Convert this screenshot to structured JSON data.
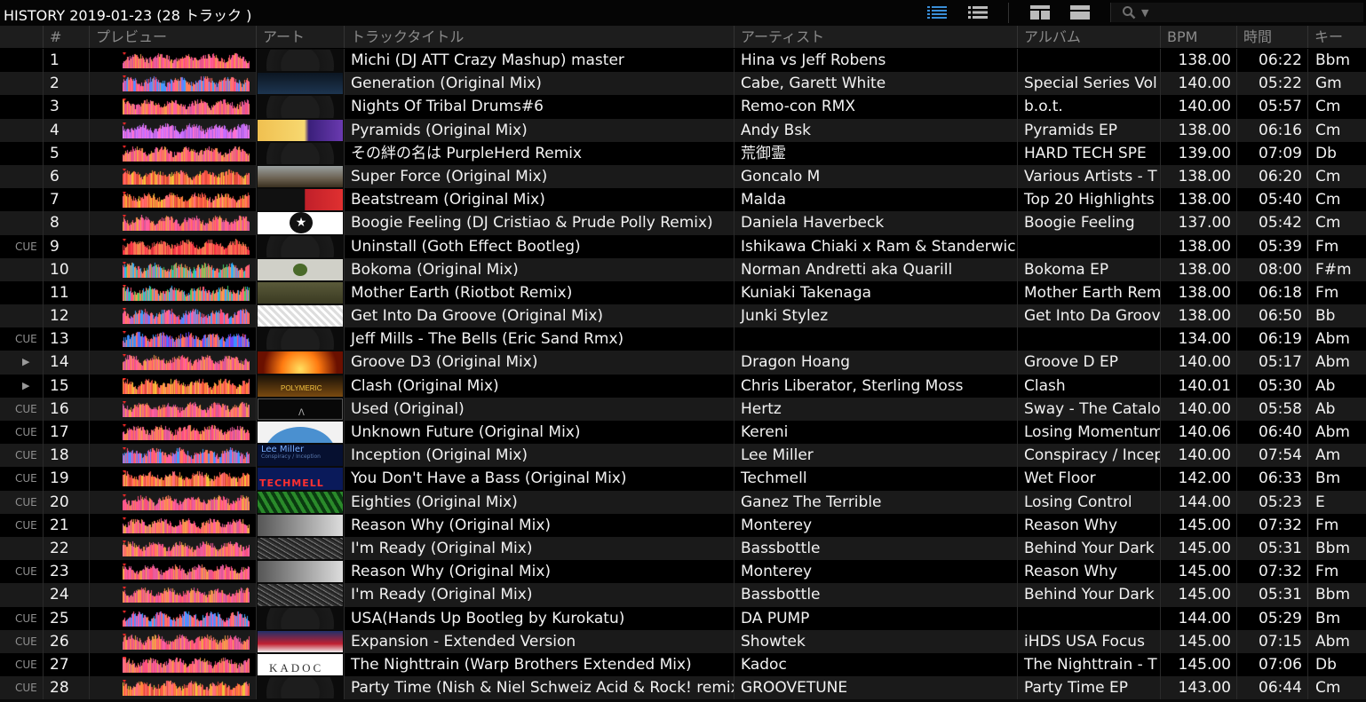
{
  "window": {
    "title": "HISTORY 2019-01-23 (28 トラック )"
  },
  "toolbar": {
    "icons": [
      "list-detail-icon",
      "list-compact-icon",
      "artwork-view-icon",
      "artwork-split-icon",
      "search-icon"
    ],
    "accent": "#3a8fd9"
  },
  "columns": [
    "#",
    "プレビュー",
    "アート",
    "トラックタイトル",
    "アーティスト",
    "アルバム",
    "BPM",
    "時間",
    "キー"
  ],
  "tracks": [
    {
      "flag": "",
      "num": "1",
      "title": "Michi (DJ ATT Crazy Mashup) master",
      "artist": "Hina vs Jeff Robens",
      "album": "",
      "bpm": "138.00",
      "time": "06:22",
      "key": "Bbm",
      "art": "disc",
      "wave": "pink"
    },
    {
      "flag": "",
      "num": "2",
      "title": "Generation (Original Mix)",
      "artist": "Cabe, Garett White",
      "album": "Special Series Vol",
      "bpm": "140.00",
      "time": "05:22",
      "key": "Gm",
      "art": "dark-blue",
      "wave": "pinkblue"
    },
    {
      "flag": "",
      "num": "3",
      "title": "Nights Of Tribal Drums#6",
      "artist": "Remo-con RMX",
      "album": "b.o.t.",
      "bpm": "140.00",
      "time": "05:57",
      "key": "Cm",
      "art": "disc",
      "wave": "pink"
    },
    {
      "flag": "",
      "num": "4",
      "title": "Pyramids (Original Mix)",
      "artist": "Andy Bsk",
      "album": "Pyramids EP",
      "bpm": "138.00",
      "time": "06:16",
      "key": "Cm",
      "art": "pyramid",
      "wave": "violet"
    },
    {
      "flag": "",
      "num": "5",
      "title": "その絆の名は PurpleHerd Remix",
      "artist": "荒御霊",
      "album": "HARD TECH SPE",
      "bpm": "139.00",
      "time": "07:09",
      "key": "Db",
      "art": "disc",
      "wave": "pink"
    },
    {
      "flag": "",
      "num": "6",
      "title": "Super Force (Original Mix)",
      "artist": "Goncalo M",
      "album": "Various Artists - T",
      "bpm": "138.00",
      "time": "06:20",
      "key": "Cm",
      "art": "landscape",
      "wave": "orange"
    },
    {
      "flag": "",
      "num": "7",
      "title": "Beatstream (Original Mix)",
      "artist": "Malda",
      "album": "Top 20 Highlights",
      "bpm": "138.00",
      "time": "05:40",
      "key": "Cm",
      "art": "red-black",
      "wave": "orange"
    },
    {
      "flag": "",
      "num": "8",
      "title": "Boogie Feeling (DJ Cristiao & Prude Polly Remix)",
      "artist": "Daniela Haverbeck",
      "album": "Boogie Feeling",
      "bpm": "137.00",
      "time": "05:42",
      "key": "Cm",
      "art": "white-star",
      "wave": "pink"
    },
    {
      "flag": "CUE",
      "num": "9",
      "title": "Uninstall (Goth Effect Bootleg)",
      "artist": "Ishikawa Chiaki x Ram & Standerwick",
      "album": "",
      "bpm": "138.00",
      "time": "05:39",
      "key": "Fm",
      "art": "disc",
      "wave": "red"
    },
    {
      "flag": "",
      "num": "10",
      "title": "Bokoma (Original Mix)",
      "artist": "Norman Andretti aka Quarill",
      "album": "Bokoma EP",
      "bpm": "138.00",
      "time": "08:00",
      "key": "F#m",
      "art": "grey-logo",
      "wave": "green"
    },
    {
      "flag": "",
      "num": "11",
      "title": "Mother Earth (Riotbot Remix)",
      "artist": "Kuniaki Takenaga",
      "album": "Mother Earth Rem",
      "bpm": "138.00",
      "time": "06:18",
      "key": "Fm",
      "art": "olive",
      "wave": "green"
    },
    {
      "flag": "",
      "num": "12",
      "title": "Get Into Da Groove (Original Mix)",
      "artist": "Junki Stylez",
      "album": "Get Into Da Groov",
      "bpm": "138.00",
      "time": "06:50",
      "key": "Bb",
      "art": "sketch",
      "wave": "pinkblue"
    },
    {
      "flag": "CUE",
      "num": "13",
      "title": "Jeff Mills - The Bells (Eric Sand Rmx)",
      "artist": "",
      "album": "",
      "bpm": "134.00",
      "time": "06:19",
      "key": "Abm",
      "art": "disc",
      "wave": "blue"
    },
    {
      "flag": "play",
      "num": "14",
      "title": "Groove D3 (Original Mix)",
      "artist": "Dragon Hoang",
      "album": "Groove D EP",
      "bpm": "140.00",
      "time": "05:17",
      "key": "Abm",
      "art": "fire",
      "wave": "pink"
    },
    {
      "flag": "play",
      "num": "15",
      "title": "Clash (Original Mix)",
      "artist": "Chris Liberator, Sterling Moss",
      "album": "Clash",
      "bpm": "140.01",
      "time": "05:30",
      "key": "Ab",
      "art": "polymeric",
      "wave": "orange"
    },
    {
      "flag": "CUE",
      "num": "16",
      "title": "Used (Original)",
      "artist": "Hertz",
      "album": "Sway - The Catalo",
      "bpm": "140.00",
      "time": "05:58",
      "key": "Ab",
      "art": "black-frame",
      "wave": "pink"
    },
    {
      "flag": "CUE",
      "num": "17",
      "title": "Unknown Future (Original Mix)",
      "artist": "Kereni",
      "album": "Losing Momentum",
      "bpm": "140.06",
      "time": "06:40",
      "key": "Abm",
      "art": "blue-dome",
      "wave": "pink"
    },
    {
      "flag": "CUE",
      "num": "18",
      "title": "Inception (Original Mix)",
      "artist": "Lee Miller",
      "album": "Conspiracy / Incep",
      "bpm": "140.00",
      "time": "07:54",
      "key": "Am",
      "art": "lee-miller",
      "wave": "pinkblue"
    },
    {
      "flag": "CUE",
      "num": "19",
      "title": "You Don't Have a Bass (Original Mix)",
      "artist": "Techmell",
      "album": "Wet Floor",
      "bpm": "142.00",
      "time": "06:33",
      "key": "Bm",
      "art": "techmell",
      "wave": "orange"
    },
    {
      "flag": "CUE",
      "num": "20",
      "title": "Eighties (Original Mix)",
      "artist": "Ganez The Terrible",
      "album": "Losing Control",
      "bpm": "144.00",
      "time": "05:23",
      "key": "E",
      "art": "green-pattern",
      "wave": "pink"
    },
    {
      "flag": "CUE",
      "num": "21",
      "title": "Reason Why (Original Mix)",
      "artist": "Monterey",
      "album": "Reason Why",
      "bpm": "145.00",
      "time": "07:32",
      "key": "Fm",
      "art": "grey-white",
      "wave": "pink"
    },
    {
      "flag": "",
      "num": "22",
      "title": "I'm Ready (Original Mix)",
      "artist": "Bassbottle",
      "album": "Behind Your Dark",
      "bpm": "145.00",
      "time": "05:31",
      "key": "Bbm",
      "art": "noise",
      "wave": "pink"
    },
    {
      "flag": "CUE",
      "num": "23",
      "title": "Reason Why (Original Mix)",
      "artist": "Monterey",
      "album": "Reason Why",
      "bpm": "145.00",
      "time": "07:32",
      "key": "Fm",
      "art": "grey-white",
      "wave": "pink"
    },
    {
      "flag": "",
      "num": "24",
      "title": "I'm Ready (Original Mix)",
      "artist": "Bassbottle",
      "album": "Behind Your Dark",
      "bpm": "145.00",
      "time": "05:31",
      "key": "Bbm",
      "art": "noise",
      "wave": "pink"
    },
    {
      "flag": "CUE",
      "num": "25",
      "title": "USA(Hands Up Bootleg by Kurokatu)",
      "artist": "DA PUMP",
      "album": "",
      "bpm": "144.00",
      "time": "05:29",
      "key": "Bm",
      "art": "disc",
      "wave": "pinkblue"
    },
    {
      "flag": "CUE",
      "num": "26",
      "title": "Expansion - Extended Version",
      "artist": "Showtek",
      "album": "iHDS USA Focus",
      "bpm": "145.00",
      "time": "07:15",
      "key": "Abm",
      "art": "usa",
      "wave": "pink"
    },
    {
      "flag": "CUE",
      "num": "27",
      "title": "The Nighttrain (Warp Brothers Extended Mix)",
      "artist": "Kadoc",
      "album": "The Nighttrain - T",
      "bpm": "145.00",
      "time": "07:06",
      "key": "Db",
      "art": "kadoc",
      "wave": "pink"
    },
    {
      "flag": "CUE",
      "num": "28",
      "title": "Party Time (Nish & Niel Schweiz Acid & Rock! remix)",
      "artist": "GROOVETUNE",
      "album": "Party Time EP",
      "bpm": "143.00",
      "time": "06:44",
      "key": "Cm",
      "art": "disc",
      "wave": "orange"
    }
  ],
  "art_labels": {
    "kadoc": "KADOC",
    "techmell": "TECHMELL",
    "polymeric": "POLYMERIC",
    "lee_miller_1": "Lee Miller",
    "lee_miller_2": "Conspiracy / Inception"
  }
}
